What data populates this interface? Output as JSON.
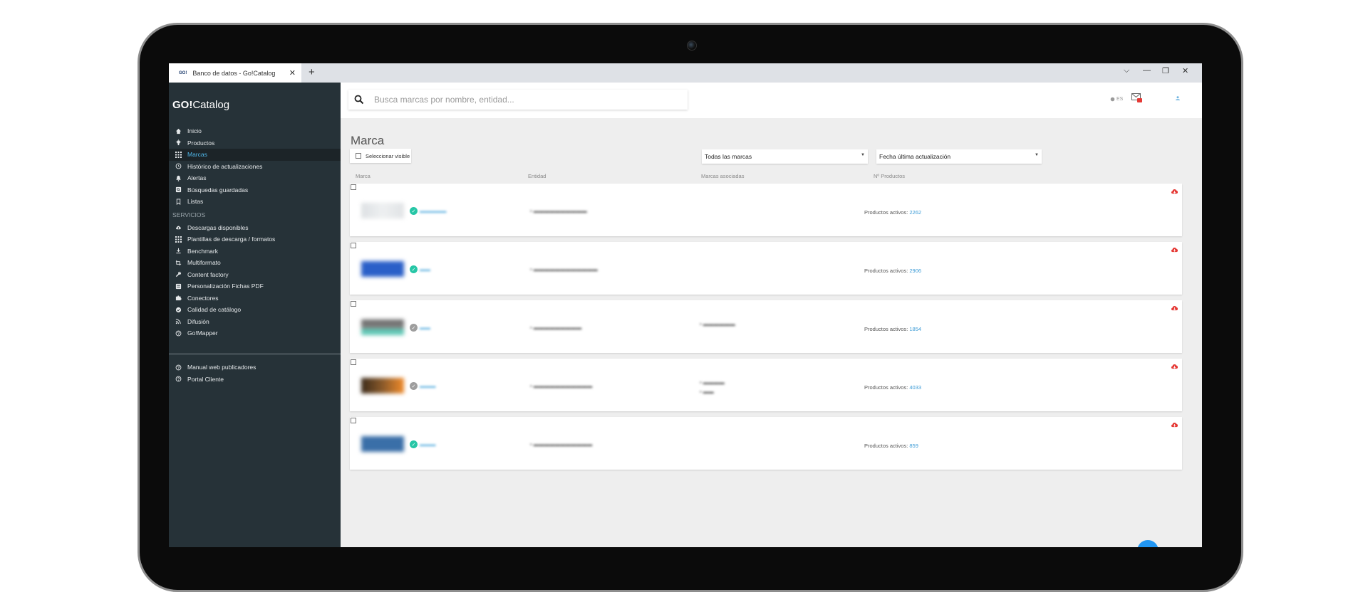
{
  "browser": {
    "favicon_text": "GO!",
    "tab_title": "Banco de datos - Go!Catalog",
    "close_tab": "✕",
    "new_tab": "+",
    "controls": [
      "⌵",
      "—",
      "❐",
      "✕"
    ]
  },
  "sidebar": {
    "logo_bold": "GO!",
    "logo_rest": "Catalog",
    "items": [
      {
        "label": "Inicio",
        "icon": "home-icon"
      },
      {
        "label": "Productos",
        "icon": "lightbulb-icon"
      },
      {
        "label": "Marcas",
        "icon": "grid-icon"
      },
      {
        "label": "Histórico de actualizaciones",
        "icon": "history-icon"
      },
      {
        "label": "Alertas",
        "icon": "bell-icon"
      },
      {
        "label": "Búsquedas guardadas",
        "icon": "saved-search-icon"
      },
      {
        "label": "Listas",
        "icon": "bookmark-icon"
      }
    ],
    "section_label": "SERVICIOS",
    "services": [
      {
        "label": "Descargas disponibles",
        "icon": "cloud-download-icon"
      },
      {
        "label": "Plantillas de descarga / formatos",
        "icon": "grid-icon"
      },
      {
        "label": "Benchmark",
        "icon": "download-icon"
      },
      {
        "label": "Multiformato",
        "icon": "transform-icon"
      },
      {
        "label": "Content factory",
        "icon": "wrench-icon"
      },
      {
        "label": "Personalización Fichas PDF",
        "icon": "pdf-icon"
      },
      {
        "label": "Conectores",
        "icon": "puzzle-icon"
      },
      {
        "label": "Calidad de catálogo",
        "icon": "check-circle-icon"
      },
      {
        "label": "Difusión",
        "icon": "rss-icon"
      },
      {
        "label": "Go!Mapper",
        "icon": "help-circle-icon"
      }
    ],
    "bottom": [
      {
        "label": "Manual web publicadores",
        "icon": "help-circle-icon"
      },
      {
        "label": "Portal Cliente",
        "icon": "help-circle-icon"
      }
    ],
    "active_index": 2
  },
  "header": {
    "search_placeholder": "Busca marcas por nombre, entidad...",
    "lang": "ES"
  },
  "main": {
    "title": "Marca",
    "select_visible": "Seleccionar visible",
    "filter_brands": "Todas las marcas",
    "sort_by": "Fecha última actualización",
    "columns": [
      "Marca",
      "Entidad",
      "Marcas asociadas",
      "Nº Productos"
    ],
    "rows": [
      {
        "products_label": "Productos activos:",
        "products": "2262",
        "verified": true
      },
      {
        "products_label": "Productos activos:",
        "products": "2906",
        "verified": true
      },
      {
        "products_label": "Productos activos:",
        "products": "1854",
        "verified": false
      },
      {
        "products_label": "Productos activos:",
        "products": "4033",
        "verified": false
      },
      {
        "products_label": "Productos activos:",
        "products": "859",
        "verified": true
      }
    ]
  },
  "colors": {
    "sidebar_bg": "#263238",
    "accent": "#4fb6e8",
    "verified": "#26c6a6",
    "unverified": "#9e9e9e",
    "download": "#e53935"
  }
}
